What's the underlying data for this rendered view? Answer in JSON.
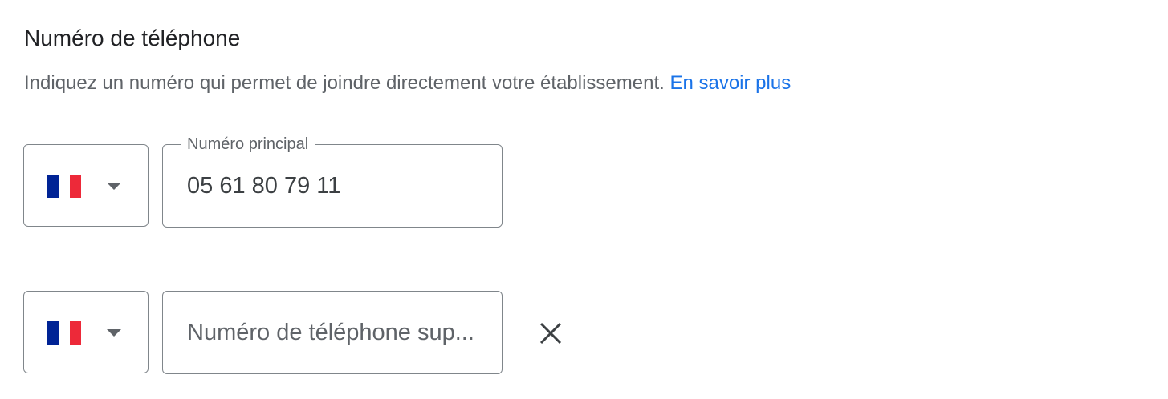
{
  "section": {
    "title": "Numéro de téléphone",
    "description": "Indiquez un numéro qui permet de joindre directement votre établissement.",
    "learn_more_link": "En savoir plus"
  },
  "primary_phone": {
    "country_flag": "france-flag-icon",
    "label": "Numéro principal",
    "value": "05 61 80 79 11"
  },
  "additional_phone": {
    "country_flag": "france-flag-icon",
    "placeholder": "Numéro de téléphone sup...",
    "value": ""
  },
  "icons": {
    "dropdown": "chevron-down-icon",
    "remove": "close-icon"
  },
  "colors": {
    "link": "#1a73e8",
    "flag_blue": "#002395",
    "flag_white": "#ffffff",
    "flag_red": "#ed2939",
    "border": "#80868b"
  }
}
